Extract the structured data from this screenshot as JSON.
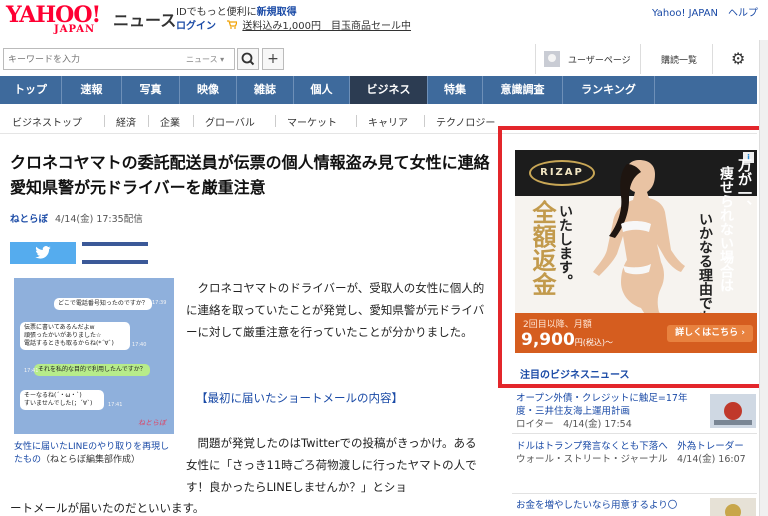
{
  "header": {
    "logo_main": "YAHOO!",
    "logo_sub": "JAPAN",
    "section_title": "ニュース",
    "promo_line1": "IDでもっと便利に",
    "promo_line1_link": "新規取得",
    "login_label": "ログイン",
    "promo_line2": "送料込み1,000円　目玉商品セール中",
    "right_links": "Yahoo! JAPAN　ヘルプ"
  },
  "search": {
    "placeholder": "キーワードを入力",
    "category": "ニュース ▾",
    "search_icon": "magnifier-icon",
    "plus_label": "+",
    "user_page": "ユーザーページ",
    "subscribe": "購読一覧",
    "gear_icon": "gear-icon"
  },
  "nav": {
    "items": [
      "トップ",
      "速報",
      "写真",
      "映像",
      "雑誌",
      "個人",
      "ビジネス",
      "特集",
      "意識調査",
      "ランキング"
    ],
    "active": "ビジネス"
  },
  "subnav": {
    "items": [
      "ビジネストップ",
      "経済",
      "企業",
      "グローバル",
      "マーケット",
      "キャリア",
      "テクノロジー"
    ]
  },
  "article": {
    "headline": "クロネコヤマトの委託配送員が伝票の個人情報盗み見て女性に連絡　愛知県警が元ドライバーを厳重注意",
    "source": "ねとらぼ",
    "date": "4/14(金) 17:35配信",
    "twitter_icon": "twitter-bird-icon",
    "facebook_icon": "facebook-icon",
    "image_chat": [
      "どこで電話番号知ったのですか？",
      "伝票に書いてあるんだよw",
      "頑張ったかいがありました☆",
      "電話するときも取るからね(*´∀`)",
      "それを私的な目的で利用したんですか？",
      "そーなるね(´・ω・`)",
      "すいませんでした(；´∀`)"
    ],
    "image_times": [
      "17:39",
      "17:40",
      "17:41",
      "17:41"
    ],
    "image_stamp": "ねとらぼ",
    "caption": "女性に届いたLINEのやり取りを再現したもの",
    "caption_paren": "（ねとらぼ編集部作成）",
    "para1": "　クロネコヤマトのドライバーが、受取人の女性に個人的に連絡を取っていたことが発覚し、愛知県警が元ドライバーに対して厳重注意を行っていたことが分かりました。",
    "section_link": "【最初に届いたショートメールの内容】",
    "para2": "　問題が発覚したのはTwitterでの投稿がきっかけ。ある女性に「さっき11時ごろ荷物渡しに行ったヤマトの人です！良かったらLINEしませんか？」とショ",
    "para3": "ートメールが届いたのだといいます。"
  },
  "ad": {
    "brand": "RIZAP",
    "info_mark": "i",
    "copy1": "万が一、",
    "copy2": "痩せられない場合は",
    "copy3": "いかなる理由でも",
    "copy_big": "全額返金",
    "copy_small": "いたします。",
    "band_line1": "2回目以降、月額",
    "band_price": "9,900",
    "band_price_suffix": "円(税込)〜",
    "band_button": "詳しくはこちら ›"
  },
  "sidebar": {
    "title": "注目のビジネスニュース",
    "news": [
      {
        "title": "オープン外債・クレジットに触足=17年度・三井住友海上運用計画",
        "meta": "ロイター　4/14(金) 17:54"
      },
      {
        "title": "ドルはトランプ発言なくとも下落へ　外為トレーダー",
        "meta": "ウォール・ストリート・ジャーナル　4/14(金) 16:07"
      },
      {
        "title": "お金を増やしたいなら用意するより〇",
        "meta": ""
      }
    ]
  },
  "colors": {
    "nav_bg": "#3e6a9c",
    "nav_active": "#2c3c52",
    "link": "#1a4aa6",
    "ad_highlight": "#e3262b",
    "yahoo_red": "#ff0033"
  }
}
